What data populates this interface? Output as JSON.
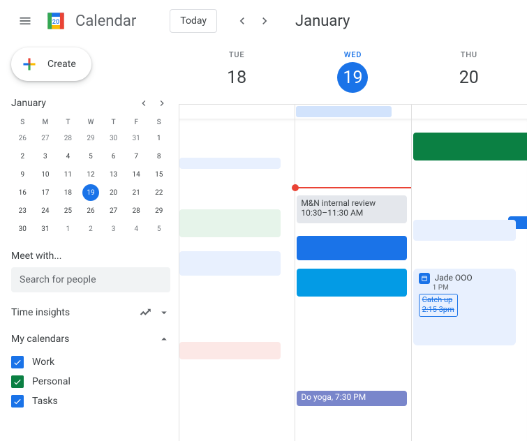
{
  "header": {
    "app_title": "Calendar",
    "logo_day": "20",
    "today_label": "Today",
    "month_title": "January"
  },
  "sidebar": {
    "create_label": "Create",
    "mini_month": "January",
    "dow": [
      "S",
      "M",
      "T",
      "W",
      "T",
      "F",
      "S"
    ],
    "weeks": [
      [
        {
          "d": "26",
          "m": true
        },
        {
          "d": "27",
          "m": true
        },
        {
          "d": "28",
          "m": true
        },
        {
          "d": "29",
          "m": true
        },
        {
          "d": "30",
          "m": true
        },
        {
          "d": "31",
          "m": true
        },
        {
          "d": "1"
        }
      ],
      [
        {
          "d": "2"
        },
        {
          "d": "3"
        },
        {
          "d": "4"
        },
        {
          "d": "5"
        },
        {
          "d": "6"
        },
        {
          "d": "7"
        },
        {
          "d": "8"
        }
      ],
      [
        {
          "d": "9"
        },
        {
          "d": "10"
        },
        {
          "d": "11"
        },
        {
          "d": "12"
        },
        {
          "d": "13"
        },
        {
          "d": "14"
        },
        {
          "d": "15"
        }
      ],
      [
        {
          "d": "16"
        },
        {
          "d": "17"
        },
        {
          "d": "18"
        },
        {
          "d": "19",
          "t": true
        },
        {
          "d": "20"
        },
        {
          "d": "21"
        },
        {
          "d": "22"
        }
      ],
      [
        {
          "d": "23"
        },
        {
          "d": "24"
        },
        {
          "d": "25"
        },
        {
          "d": "26"
        },
        {
          "d": "27"
        },
        {
          "d": "28"
        },
        {
          "d": "29"
        }
      ],
      [
        {
          "d": "30"
        },
        {
          "d": "31"
        },
        {
          "d": "1",
          "m": true
        },
        {
          "d": "2",
          "m": true
        },
        {
          "d": "3",
          "m": true
        },
        {
          "d": "4",
          "m": true
        },
        {
          "d": "5",
          "m": true
        }
      ]
    ],
    "meet_with_label": "Meet with...",
    "search_placeholder": "Search for people",
    "time_insights_label": "Time insights",
    "my_calendars_label": "My calendars",
    "calendars": [
      {
        "label": "Work",
        "color": "#1a73e8"
      },
      {
        "label": "Personal",
        "color": "#0b8043"
      },
      {
        "label": "Tasks",
        "color": "#1a73e8"
      }
    ]
  },
  "grid": {
    "days": [
      {
        "dow": "TUE",
        "num": "18",
        "active": false
      },
      {
        "dow": "WED",
        "num": "19",
        "active": true
      },
      {
        "dow": "THU",
        "num": "20",
        "active": false
      }
    ],
    "events": {
      "mn_review": {
        "title": "M&N internal review",
        "time": "10:30–11:30 AM"
      },
      "yoga": {
        "title": "Do yoga, 7:30 PM"
      },
      "ooo": {
        "name": "Jade OOO",
        "time": "1 PM",
        "catchup_title": "Catch up",
        "catchup_time": "2:15 3pm"
      }
    }
  }
}
